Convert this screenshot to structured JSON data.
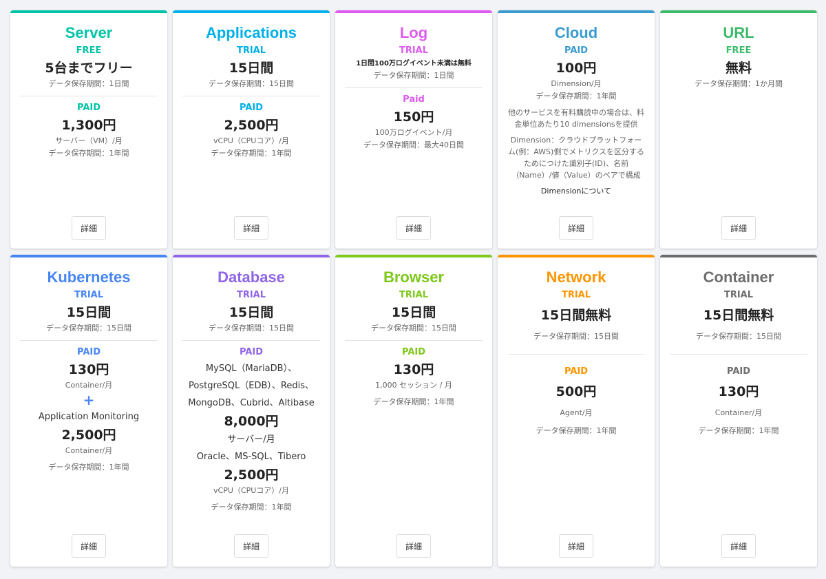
{
  "detail_label": "詳細",
  "cards": [
    {
      "name": "Server",
      "color": "#00c4a7",
      "lines": [
        {
          "t": "tier",
          "v": "FREE"
        },
        {
          "t": "big",
          "v": "5台までフリー"
        },
        {
          "t": "small",
          "v": "データ保存期間：1日間"
        },
        {
          "t": "divider"
        },
        {
          "t": "tier",
          "v": "PAID"
        },
        {
          "t": "big",
          "v": "1,300円"
        },
        {
          "t": "small",
          "v": "サーバー（VM）/月"
        },
        {
          "t": "small",
          "v": "データ保存期間：1年間"
        }
      ]
    },
    {
      "name": "Applications",
      "color": "#00b0e8",
      "lines": [
        {
          "t": "tier",
          "v": "TRIAL"
        },
        {
          "t": "big",
          "v": "15日間"
        },
        {
          "t": "small",
          "v": "データ保存期間：15日間"
        },
        {
          "t": "divider"
        },
        {
          "t": "tier",
          "v": "PAID"
        },
        {
          "t": "big",
          "v": "2,500円"
        },
        {
          "t": "small",
          "v": "vCPU（CPUコア）/月"
        },
        {
          "t": "small",
          "v": "データ保存期間：1年間"
        }
      ]
    },
    {
      "name": "Log",
      "color": "#de5bf0",
      "lines": [
        {
          "t": "tier",
          "v": "TRIAL"
        },
        {
          "t": "note",
          "v": "1日間100万ログイベント未満は無料"
        },
        {
          "t": "small",
          "v": "データ保存期間：1日間"
        },
        {
          "t": "divider"
        },
        {
          "t": "tier",
          "v": "Paid"
        },
        {
          "t": "big",
          "v": "150円"
        },
        {
          "t": "small",
          "v": "100万ログイベント/月"
        },
        {
          "t": "small",
          "v": "データ保存期間：最大40日間"
        }
      ]
    },
    {
      "name": "Cloud",
      "color": "#3a9bd0",
      "lines": [
        {
          "t": "tier",
          "v": "PAID"
        },
        {
          "t": "big",
          "v": "100円"
        },
        {
          "t": "small",
          "v": "Dimension/月"
        },
        {
          "t": "small",
          "v": "データ保存期間：1年間"
        },
        {
          "t": "para",
          "v": "他のサービスを有料購読中の場合は、料金単位あたり10 dimensionsを提供"
        },
        {
          "t": "para",
          "v": "Dimension：クラウドプラットフォーム(例：AWS)側でメトリクスを区分するためにつけた識別子(ID)、名前（Name）/値（Value）のペアで構成"
        },
        {
          "t": "link",
          "v": "Dimensionについて"
        }
      ]
    },
    {
      "name": "URL",
      "color": "#3dbb6b",
      "lines": [
        {
          "t": "tier",
          "v": "FREE"
        },
        {
          "t": "big",
          "v": "無料"
        },
        {
          "t": "small",
          "v": "データ保存期間：1か月間"
        }
      ]
    },
    {
      "name": "Kubernetes",
      "color": "#4785f5",
      "lines": [
        {
          "t": "tier",
          "v": "TRIAL"
        },
        {
          "t": "big",
          "v": "15日間"
        },
        {
          "t": "small",
          "v": "データ保存期間：15日間"
        },
        {
          "t": "divider"
        },
        {
          "t": "tier",
          "v": "PAID"
        },
        {
          "t": "big",
          "v": "130円"
        },
        {
          "t": "small",
          "v": "Container/月"
        },
        {
          "t": "plus",
          "v": "+"
        },
        {
          "t": "text",
          "v": "Application Monitoring"
        },
        {
          "t": "big",
          "v": "2,500円"
        },
        {
          "t": "small",
          "v": "Container/月"
        },
        {
          "t": "para",
          "v": "データ保存期間：1年間"
        }
      ]
    },
    {
      "name": "Database",
      "color": "#8f66e8",
      "lines": [
        {
          "t": "tier",
          "v": "TRIAL"
        },
        {
          "t": "big",
          "v": "15日間"
        },
        {
          "t": "small",
          "v": "データ保存期間：15日間"
        },
        {
          "t": "divider"
        },
        {
          "t": "tier",
          "v": "PAID"
        },
        {
          "t": "text",
          "v": "MySQL（MariaDB）、PostgreSQL（EDB）、Redis、MongoDB、Cubrid、Altibase"
        },
        {
          "t": "big",
          "v": "8,000円"
        },
        {
          "t": "text",
          "v": "サーバー/月"
        },
        {
          "t": "text",
          "v": "Oracle、MS-SQL、Tibero"
        },
        {
          "t": "big",
          "v": "2,500円"
        },
        {
          "t": "small",
          "v": "vCPU（CPUコア）/月"
        },
        {
          "t": "para",
          "v": "データ保存期間：1年間"
        }
      ]
    },
    {
      "name": "Browser",
      "color": "#7ec81a",
      "lines": [
        {
          "t": "tier",
          "v": "TRIAL"
        },
        {
          "t": "big",
          "v": "15日間"
        },
        {
          "t": "small",
          "v": "データ保存期間：15日間"
        },
        {
          "t": "divider"
        },
        {
          "t": "tier",
          "v": "PAID"
        },
        {
          "t": "big",
          "v": "130円"
        },
        {
          "t": "small",
          "v": "1,000 セッション / 月"
        },
        {
          "t": "para",
          "v": "データ保存期間：1年間"
        }
      ]
    },
    {
      "name": "Network",
      "color": "#ff9500",
      "lines": [
        {
          "t": "tier",
          "v": "TRIAL"
        },
        {
          "t": "big",
          "v": "15日間無料"
        },
        {
          "t": "small",
          "v": "データ保存期間：15日間"
        },
        {
          "t": "divider"
        },
        {
          "t": "tier",
          "v": "PAID"
        },
        {
          "t": "big",
          "v": "500円"
        },
        {
          "t": "small",
          "v": "Agent/月"
        },
        {
          "t": "small",
          "v": "データ保存期間：1年間"
        }
      ]
    },
    {
      "name": "Container",
      "color": "#6d6d6d",
      "lines": [
        {
          "t": "tier",
          "v": "TRIAL"
        },
        {
          "t": "big",
          "v": "15日間無料"
        },
        {
          "t": "small",
          "v": "データ保存期間：15日間"
        },
        {
          "t": "divider"
        },
        {
          "t": "tier",
          "v": "PAID"
        },
        {
          "t": "big",
          "v": "130円"
        },
        {
          "t": "small",
          "v": "Container/月"
        },
        {
          "t": "small",
          "v": "データ保存期間：1年間"
        }
      ]
    }
  ]
}
